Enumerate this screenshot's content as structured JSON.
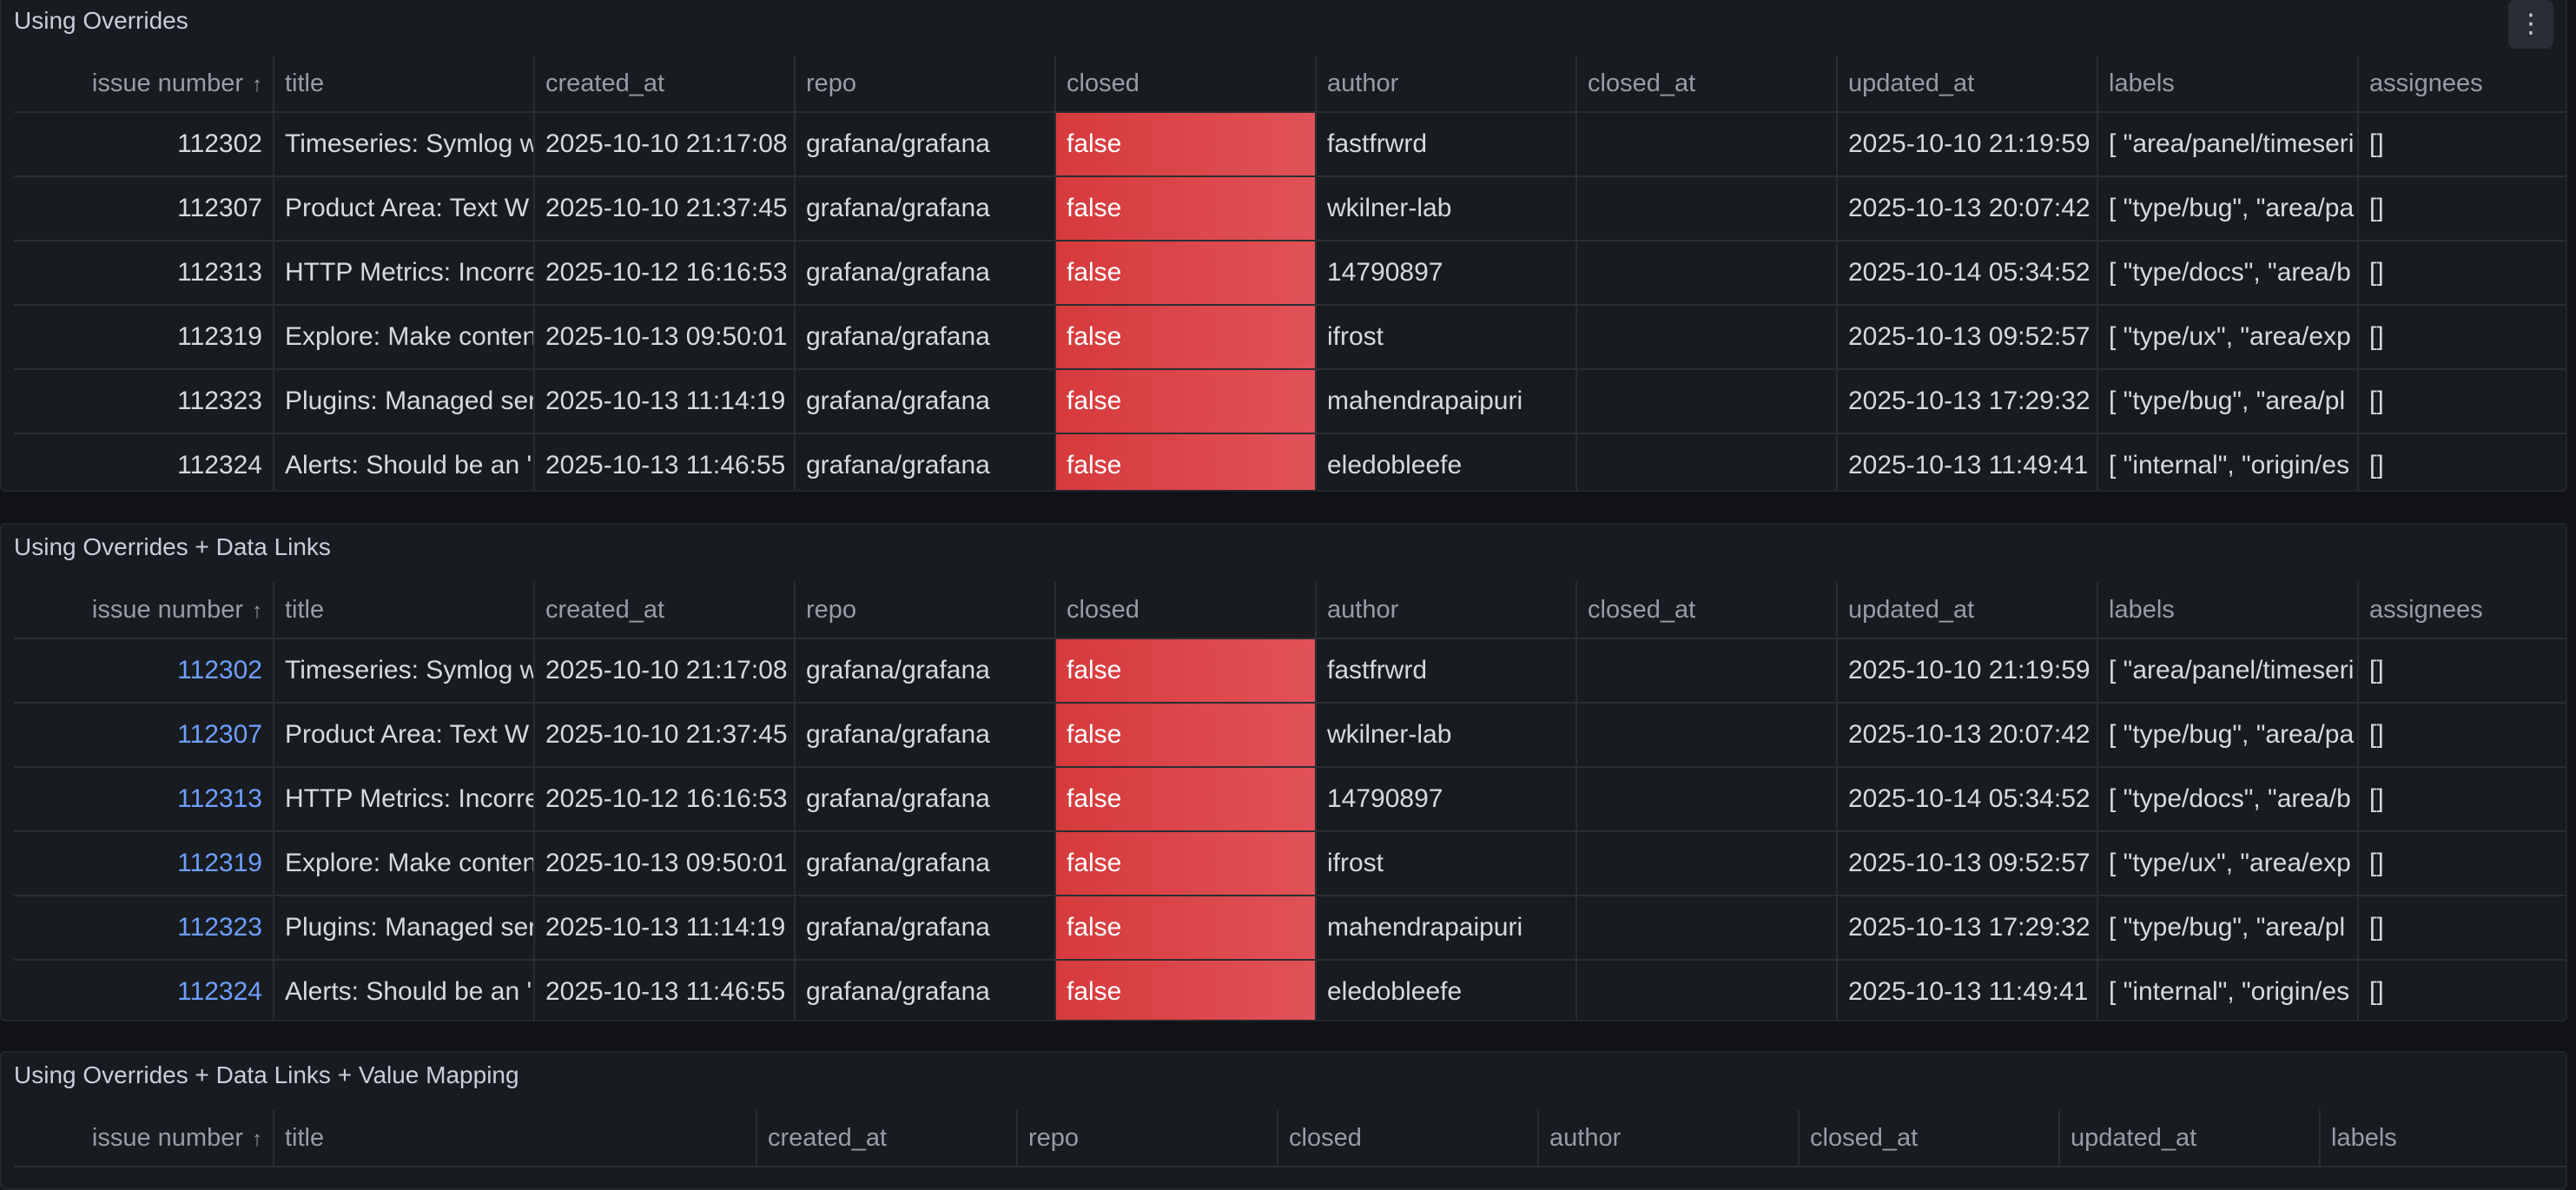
{
  "panels": [
    {
      "title": "Using Overrides",
      "menu_icon": "vertical-ellipsis-icon",
      "menu_glyph": "⋮",
      "links": false
    },
    {
      "title": "Using Overrides + Data Links",
      "links": true
    },
    {
      "title": "Using Overrides + Data Links + Value Mapping",
      "links": false
    }
  ],
  "columns": {
    "issue_number": "issue number",
    "title": "title",
    "created_at": "created_at",
    "repo": "repo",
    "closed": "closed",
    "author": "author",
    "closed_at": "closed_at",
    "updated_at": "updated_at",
    "labels": "labels",
    "assignees": "assignees",
    "sort_glyph": "↑",
    "sort_icon": "sort-ascending-icon"
  },
  "rows": [
    {
      "issue_number": "112302",
      "title": "Timeseries: Symlog w",
      "created_at": "2025-10-10 21:17:08",
      "repo": "grafana/grafana",
      "closed": "false",
      "author": "fastfrwrd",
      "closed_at": "",
      "updated_at": "2025-10-10 21:19:59",
      "labels": "[ \"area/panel/timeseri",
      "assignees": "[]"
    },
    {
      "issue_number": "112307",
      "title": "Product Area: Text W",
      "created_at": "2025-10-10 21:37:45",
      "repo": "grafana/grafana",
      "closed": "false",
      "author": "wkilner-lab",
      "closed_at": "",
      "updated_at": "2025-10-13 20:07:42",
      "labels": "[ \"type/bug\", \"area/pa",
      "assignees": "[]"
    },
    {
      "issue_number": "112313",
      "title": "HTTP Metrics: Incorre",
      "created_at": "2025-10-12 16:16:53",
      "repo": "grafana/grafana",
      "closed": "false",
      "author": "14790897",
      "closed_at": "",
      "updated_at": "2025-10-14 05:34:52",
      "labels": "[ \"type/docs\", \"area/b",
      "assignees": "[]"
    },
    {
      "issue_number": "112319",
      "title": "Explore: Make conten",
      "created_at": "2025-10-13 09:50:01",
      "repo": "grafana/grafana",
      "closed": "false",
      "author": "ifrost",
      "closed_at": "",
      "updated_at": "2025-10-13 09:52:57",
      "labels": "[ \"type/ux\", \"area/exp",
      "assignees": "[]"
    },
    {
      "issue_number": "112323",
      "title": "Plugins: Managed ser",
      "created_at": "2025-10-13 11:14:19",
      "repo": "grafana/grafana",
      "closed": "false",
      "author": "mahendrapaipuri",
      "closed_at": "",
      "updated_at": "2025-10-13 17:29:32",
      "labels": "[ \"type/bug\", \"area/pl",
      "assignees": "[]"
    },
    {
      "issue_number": "112324",
      "title": "Alerts: Should be an '",
      "created_at": "2025-10-13 11:46:55",
      "repo": "grafana/grafana",
      "closed": "false",
      "author": "eledobleefe",
      "closed_at": "",
      "updated_at": "2025-10-13 11:49:41",
      "labels": "[ \"internal\", \"origin/es",
      "assignees": "[]"
    }
  ],
  "colors": {
    "background": "#111217",
    "panel": "#181b1f",
    "closed_false_fill": "#d63a3c",
    "link": "#6e9fff"
  }
}
